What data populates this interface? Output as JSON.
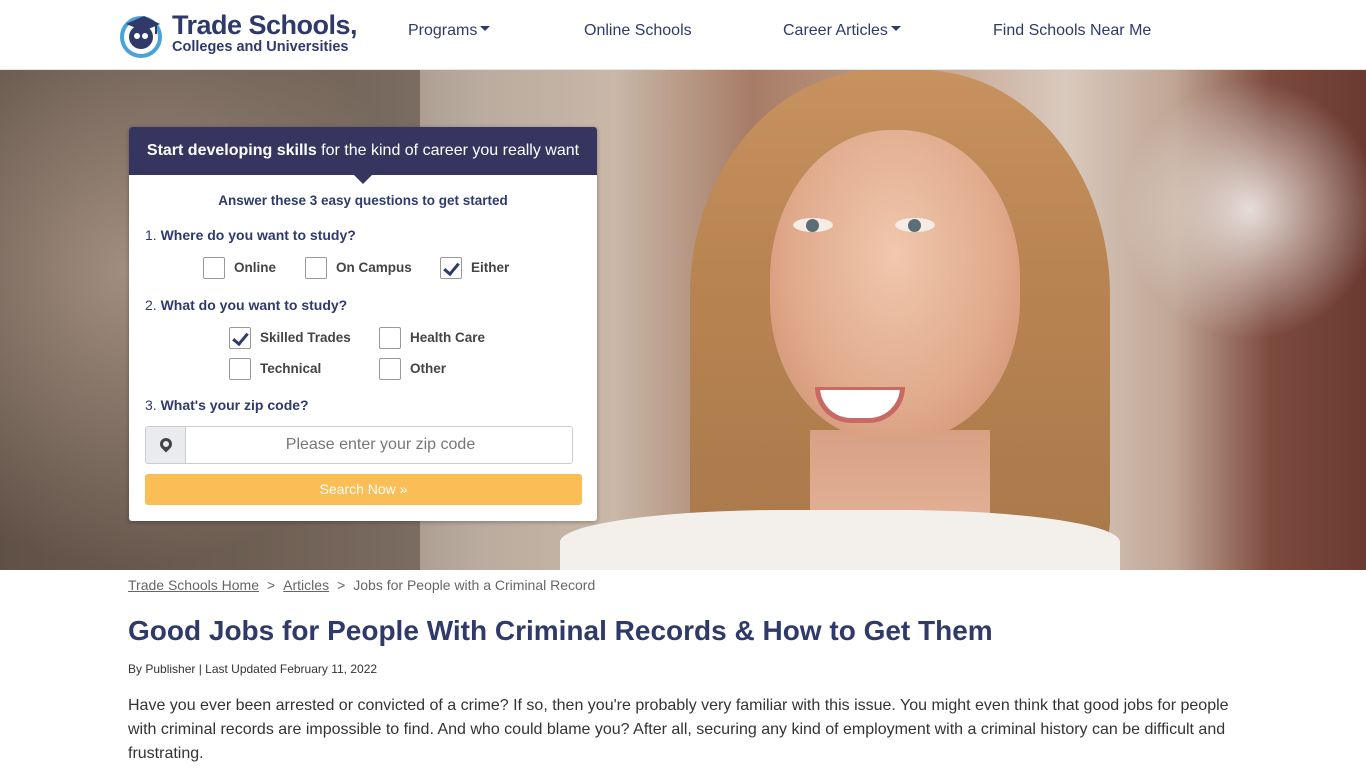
{
  "header": {
    "logo_title": "Trade Schools,",
    "logo_subtitle": "Colleges and Universities",
    "nav": [
      {
        "label": "Programs",
        "dropdown": true
      },
      {
        "label": "Online Schools",
        "dropdown": false
      },
      {
        "label": "Career Articles",
        "dropdown": true
      },
      {
        "label": "Find Schools Near Me",
        "dropdown": false
      }
    ]
  },
  "form": {
    "head_bold": "Start developing skills",
    "head_rest": " for the kind of career you really want",
    "subtitle": "Answer these 3 easy questions to get started",
    "q1": {
      "num": "1. ",
      "text": "Where do you want to study?",
      "options": [
        {
          "label": "Online",
          "checked": false
        },
        {
          "label": "On Campus",
          "checked": false
        },
        {
          "label": "Either",
          "checked": true
        }
      ]
    },
    "q2": {
      "num": "2. ",
      "text": "What do you want to study?",
      "options": [
        {
          "label": "Skilled Trades",
          "checked": true
        },
        {
          "label": "Health Care",
          "checked": false
        },
        {
          "label": "Technical",
          "checked": false
        },
        {
          "label": "Other",
          "checked": false
        }
      ]
    },
    "q3": {
      "num": "3. ",
      "text": "What's your zip code?"
    },
    "zip_placeholder": "Please enter your zip code",
    "search_label": "Search Now »"
  },
  "breadcrumb": {
    "home": "Trade Schools Home",
    "separator": ">",
    "articles": "Articles",
    "current": "Jobs for People with a Criminal Record"
  },
  "article": {
    "title": "Good Jobs for People With Criminal Records & How to Get Them",
    "meta": "By Publisher | Last Updated February 11, 2022",
    "intro": "Have you ever been arrested or convicted of a crime? If so, then you're probably very familiar with this issue. You might even think that good jobs for people with criminal records are impossible to find. And who could blame you? After all, securing any kind of employment with a criminal history can be difficult and frustrating."
  },
  "colors": {
    "brand_navy": "#2f3a6b",
    "form_header": "#35355f",
    "search_button": "#fbbd55"
  }
}
